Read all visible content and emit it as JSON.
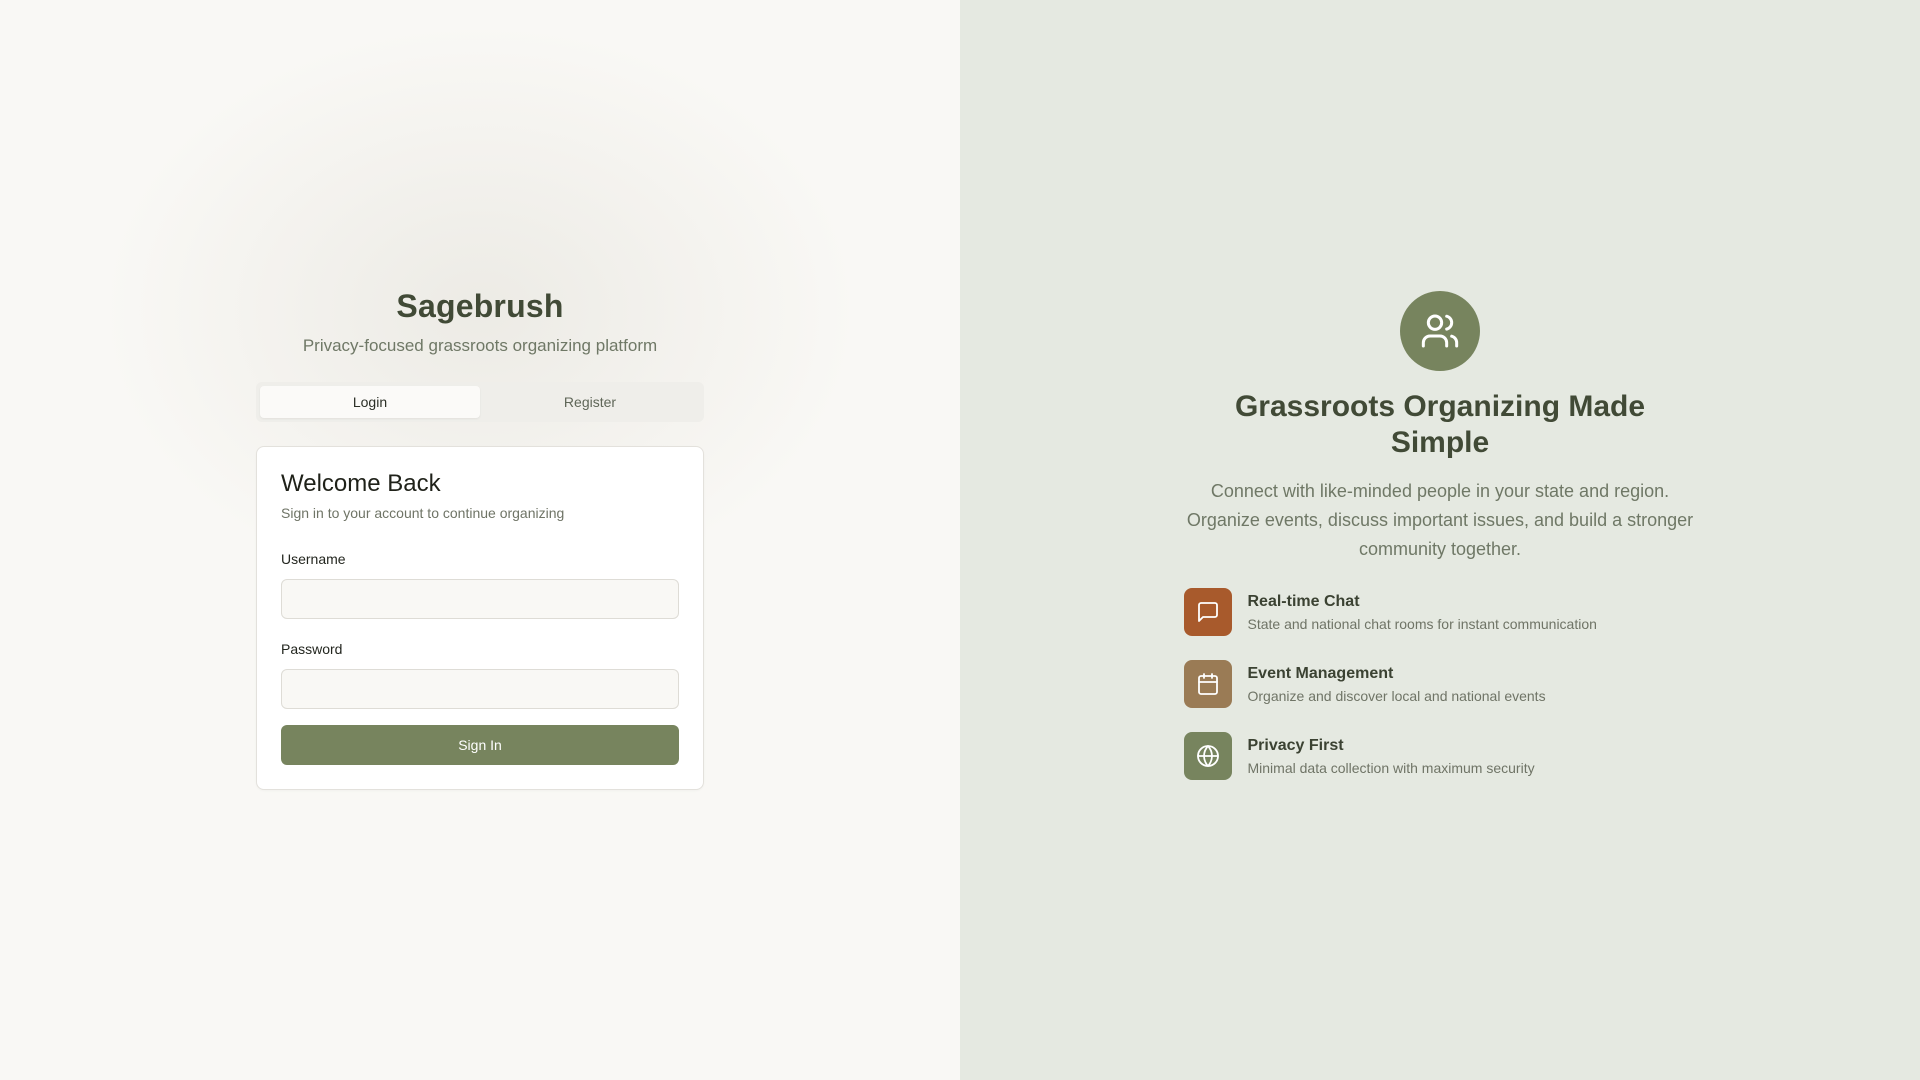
{
  "brand": {
    "title": "Sagebrush",
    "subtitle": "Privacy-focused grassroots organizing platform"
  },
  "tabs": [
    {
      "label": "Login",
      "active": true
    },
    {
      "label": "Register",
      "active": false
    }
  ],
  "login_card": {
    "title": "Welcome Back",
    "subtitle": "Sign in to your account to continue organizing",
    "username_label": "Username",
    "username_value": "",
    "password_label": "Password",
    "password_value": "",
    "submit_label": "Sign In"
  },
  "hero": {
    "icon": "users-icon",
    "title": "Grassroots Organizing Made Simple",
    "description": "Connect with like-minded people in your state and region. Organize events, discuss important issues, and build a stronger community together."
  },
  "features": [
    {
      "icon": "message-square-icon",
      "color": "#a85a2c",
      "title": "Real-time Chat",
      "description": "State and national chat rooms for instant communication"
    },
    {
      "icon": "calendar-icon",
      "color": "#9a7b55",
      "title": "Event Management",
      "description": "Organize and discover local and national events"
    },
    {
      "icon": "globe-icon",
      "color": "#77845e",
      "title": "Privacy First",
      "description": "Minimal data collection with maximum security"
    }
  ],
  "colors": {
    "primary": "#77845e",
    "heading": "#414a36",
    "left_bg": "#f9f8f5",
    "right_bg": "#e5e9e1"
  }
}
